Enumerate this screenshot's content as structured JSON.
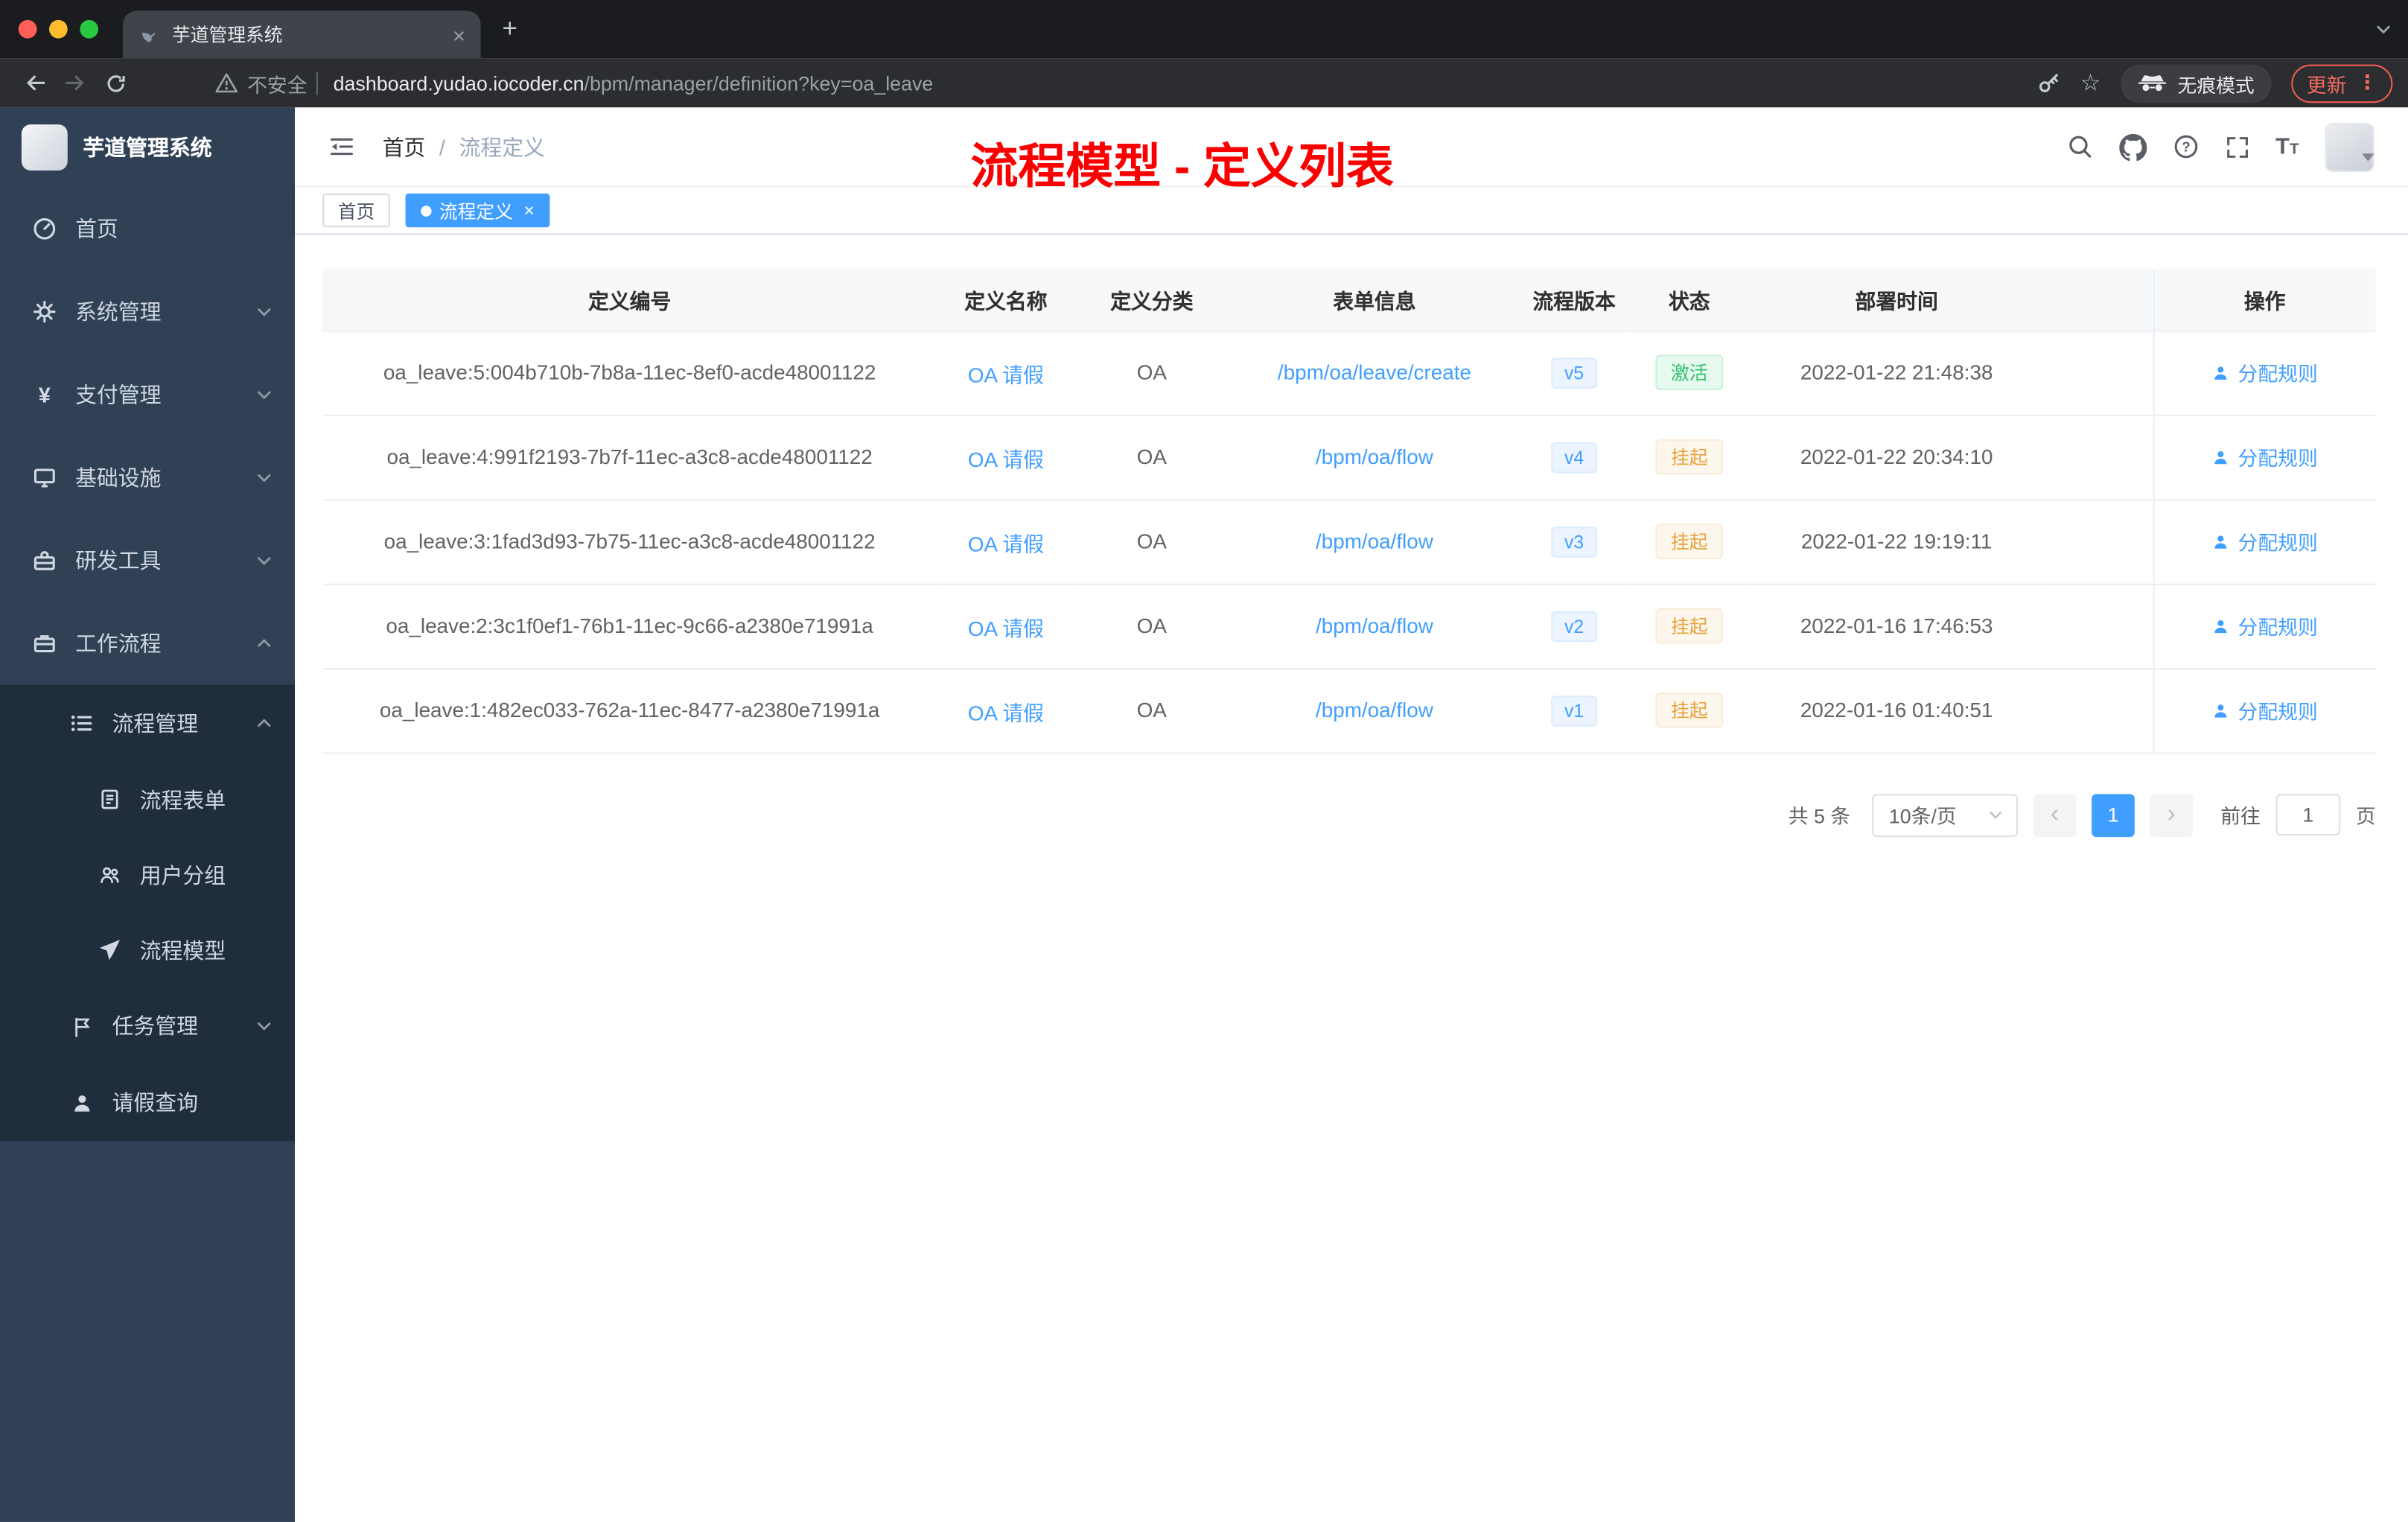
{
  "colors": {
    "accent_blue": "#409eff",
    "success_green": "#2fbf6b",
    "warning_orange": "#e6a23c",
    "annotation_red": "#fa0000",
    "sidebar_bg": "#304156",
    "submenu_bg": "#1f2d3d"
  },
  "icons": {
    "tab_close": "×",
    "new_tab": "+",
    "tag_close": "×",
    "yen": "¥",
    "star": "☆",
    "kebab": "⋮",
    "prev_arrow": "‹",
    "next_arrow": "›"
  },
  "browser": {
    "tab_title": "芋道管理系统",
    "security_label": "不安全",
    "url_domain": "dashboard.yudao.iocoder.cn",
    "url_path": "/bpm/manager/definition?key=oa_leave",
    "incognito_label": "无痕模式",
    "update_label": "更新"
  },
  "sidebar": {
    "logo_title": "芋道管理系统",
    "items": [
      {
        "label": "首页"
      },
      {
        "label": "系统管理"
      },
      {
        "label": "支付管理"
      },
      {
        "label": "基础设施"
      },
      {
        "label": "研发工具"
      },
      {
        "label": "工作流程"
      }
    ],
    "process_group": {
      "label": "流程管理",
      "children": [
        {
          "label": "流程表单"
        },
        {
          "label": "用户分组"
        },
        {
          "label": "流程模型"
        }
      ]
    },
    "task_item": {
      "label": "任务管理"
    },
    "leave_item": {
      "label": "请假查询"
    }
  },
  "header": {
    "breadcrumb_home": "首页",
    "breadcrumb_separator": "/",
    "breadcrumb_current": "流程定义",
    "annotation": "流程模型 - 定义列表"
  },
  "tags": {
    "home": "首页",
    "current": "流程定义"
  },
  "table": {
    "columns": [
      "定义编号",
      "定义名称",
      "定义分类",
      "表单信息",
      "流程版本",
      "状态",
      "部署时间",
      "操作"
    ],
    "rows": [
      {
        "id": "oa_leave:5:004b710b-7b8a-11ec-8ef0-acde48001122",
        "name": "OA 请假",
        "category": "OA",
        "form": "/bpm/oa/leave/create",
        "version": "v5",
        "status": "激活",
        "time": "2022-01-22 21:48:38",
        "action": "分配规则"
      },
      {
        "id": "oa_leave:4:991f2193-7b7f-11ec-a3c8-acde48001122",
        "name": "OA 请假",
        "category": "OA",
        "form": "/bpm/oa/flow",
        "version": "v4",
        "status": "挂起",
        "time": "2022-01-22 20:34:10",
        "action": "分配规则"
      },
      {
        "id": "oa_leave:3:1fad3d93-7b75-11ec-a3c8-acde48001122",
        "name": "OA 请假",
        "category": "OA",
        "form": "/bpm/oa/flow",
        "version": "v3",
        "status": "挂起",
        "time": "2022-01-22 19:19:11",
        "action": "分配规则"
      },
      {
        "id": "oa_leave:2:3c1f0ef1-76b1-11ec-9c66-a2380e71991a",
        "name": "OA 请假",
        "category": "OA",
        "form": "/bpm/oa/flow",
        "version": "v2",
        "status": "挂起",
        "time": "2022-01-16 17:46:53",
        "action": "分配规则"
      },
      {
        "id": "oa_leave:1:482ec033-762a-11ec-8477-a2380e71991a",
        "name": "OA 请假",
        "category": "OA",
        "form": "/bpm/oa/flow",
        "version": "v1",
        "status": "挂起",
        "time": "2022-01-16 01:40:51",
        "action": "分配规则"
      }
    ]
  },
  "pagination": {
    "total": "共 5 条",
    "page_size": "10条/页",
    "current_page": "1",
    "goto_label": "前往",
    "goto_value": "1",
    "goto_suffix": "页"
  }
}
